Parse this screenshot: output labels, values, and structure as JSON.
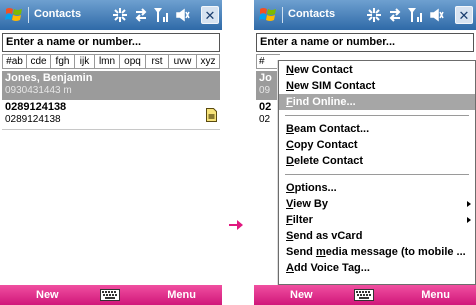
{
  "colors": {
    "titlebar": "#2f6aa8",
    "softbar": "#d0177a",
    "selection": "#9b9b9b",
    "menu_highlight": "#a6a6a6",
    "arrow": "#e0187f"
  },
  "left_screen": {
    "title": "Contacts",
    "search_placeholder": "Enter a name or number...",
    "alpha_tabs": [
      "#ab",
      "cde",
      "fgh",
      "ijk",
      "lmn",
      "opq",
      "rst",
      "uvw",
      "xyz"
    ],
    "contacts": [
      {
        "name": "Jones, Benjamin",
        "detail": "0930431443  m",
        "selected": true
      },
      {
        "name": "0289124138",
        "detail": "0289124138",
        "selected": false,
        "icon": "sim-card-icon"
      }
    ],
    "softkeys": {
      "left": "New",
      "right": "Menu",
      "center_icon": "keyboard-icon"
    }
  },
  "right_screen": {
    "title": "Contacts",
    "search_placeholder": "Enter a name or number...",
    "visible_tab_fragment": "#",
    "visible_contact_fragments": [
      "Jo",
      "09",
      "02",
      "02"
    ],
    "menu": {
      "groups": [
        [
          {
            "label": "New Contact",
            "access_key": "N"
          },
          {
            "label": "New SIM Contact",
            "access_key": "N"
          },
          {
            "label": "Find Online...",
            "access_key": "F",
            "highlighted": true
          }
        ],
        [
          {
            "label": "Beam Contact...",
            "access_key": "B"
          },
          {
            "label": "Copy Contact",
            "access_key": "C"
          },
          {
            "label": "Delete Contact",
            "access_key": "D"
          }
        ],
        [
          {
            "label": "Options...",
            "access_key": "O"
          },
          {
            "label": "View By",
            "access_key": "V",
            "submenu": true
          },
          {
            "label": "Filter",
            "access_key": "F",
            "submenu": true
          },
          {
            "label": "Send as vCard",
            "access_key": "S"
          },
          {
            "label": "Send media message (to mobile  ...",
            "access_key": "m"
          },
          {
            "label": "Add Voice Tag...",
            "access_key": "A"
          }
        ]
      ]
    },
    "softkeys": {
      "left": "New",
      "right": "Menu",
      "center_icon": "keyboard-icon"
    }
  },
  "transition_arrow": "right-arrow-icon"
}
